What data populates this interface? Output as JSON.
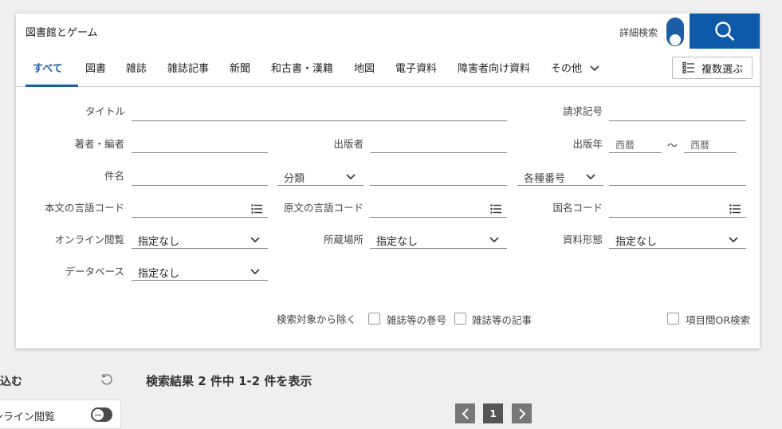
{
  "search": {
    "query": "図書館とゲーム",
    "advanced_label": "詳細検索",
    "advanced_enabled": true
  },
  "tabs": [
    {
      "label": "すべて",
      "active": true
    },
    {
      "label": "図書"
    },
    {
      "label": "雑誌"
    },
    {
      "label": "雑誌記事"
    },
    {
      "label": "新聞"
    },
    {
      "label": "和古書・漢籍"
    },
    {
      "label": "地図"
    },
    {
      "label": "電子資料"
    },
    {
      "label": "障害者向け資料"
    },
    {
      "label": "その他"
    }
  ],
  "multi_select_label": "複数選ぶ",
  "form": {
    "title": "タイトル",
    "call_number": "請求記号",
    "author": "著者・編者",
    "publisher": "出版者",
    "pub_year": "出版年",
    "year_from_placeholder": "西暦",
    "year_tilde": "～",
    "year_to_placeholder": "西暦",
    "subject": "件名",
    "classification": "分類",
    "id_numbers": "各種番号",
    "text_language": "本文の言語コード",
    "original_language": "原文の言語コード",
    "country_code": "国名コード",
    "online_access": "オンライン閲覧",
    "online_access_value": "指定なし",
    "location": "所蔵場所",
    "location_value": "指定なし",
    "material_type": "資料形態",
    "material_type_value": "指定なし",
    "database": "データベース",
    "database_value": "指定なし",
    "exclude_label": "検索対象から除く",
    "exclude_volumes": "雑誌等の巻号",
    "exclude_articles": "雑誌等の記事",
    "or_search": "項目間OR検索"
  },
  "sidebar": {
    "title": "絞り込む",
    "item_label": "オンライン閲覧"
  },
  "results_text": "検索結果 2 件中 1-2 件を表示",
  "pagination": {
    "current": "1"
  },
  "colors": {
    "accent": "#0f5aa8",
    "tab_active": "#1a5fa6"
  }
}
